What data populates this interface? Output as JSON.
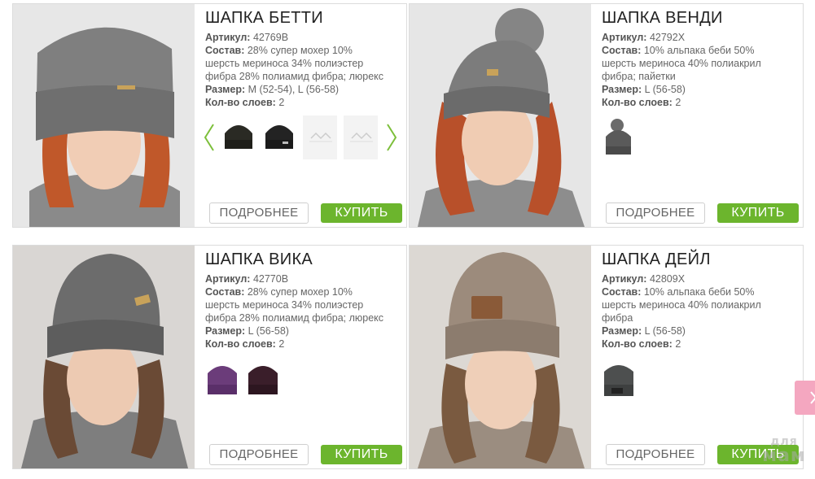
{
  "labels": {
    "article": "Артикул:",
    "composition": "Состав:",
    "size": "Размер:",
    "layers": "Кол-во слоев:"
  },
  "buttons": {
    "more": "ПОДРОБНЕЕ",
    "buy": "КУПИТЬ"
  },
  "colors": {
    "buy_green": "#6cb52d",
    "side_tab_pink": "#f4a7c0"
  },
  "products": [
    {
      "title": "ШАПКА БЕТТИ",
      "article": "42769В",
      "composition": [
        "28% супер мохер 10%",
        "шерсть мериноса 34% полиэстер",
        "фибра 28% полиамид фибра; люрекс"
      ],
      "size": "M (52-54), L (56-58)",
      "layers": "2",
      "thumbnails": [
        "black-hat-thumbnail",
        "black-hat-thumbnail",
        "placeholder-thumbnail",
        "placeholder-thumbnail"
      ]
    },
    {
      "title": "ШАПКА ВЕНДИ",
      "article": "42792Х",
      "composition": [
        "10% альпака беби 50%",
        "шерсть мериноса 40% полиакрил",
        "фибра; пайетки"
      ],
      "size": "L (56-58)",
      "layers": "2",
      "thumbnails": [
        "grey-pompom-hat-thumbnail"
      ]
    },
    {
      "title": "ШАПКА ВИКА",
      "article": "42770В",
      "composition": [
        "28% супер мохер 10%",
        "шерсть мериноса 34% полиэстер",
        "фибра 28% полиамид фибра; люрекс"
      ],
      "size": "L (56-58)",
      "layers": "2",
      "thumbnails": [
        "purple-hat-thumbnail",
        "plum-hat-thumbnail"
      ]
    },
    {
      "title": "ШАПКА ДЕЙЛ",
      "article": "42809Х",
      "composition": [
        "10% альпака беби 50%",
        "шерсть мериноса 40% полиакрил",
        "фибра"
      ],
      "size": "L (56-58)",
      "layers": "2",
      "thumbnails": [
        "grey-hat-thumbnail"
      ]
    }
  ],
  "watermark": {
    "line1": "для",
    "line2": "мам"
  }
}
